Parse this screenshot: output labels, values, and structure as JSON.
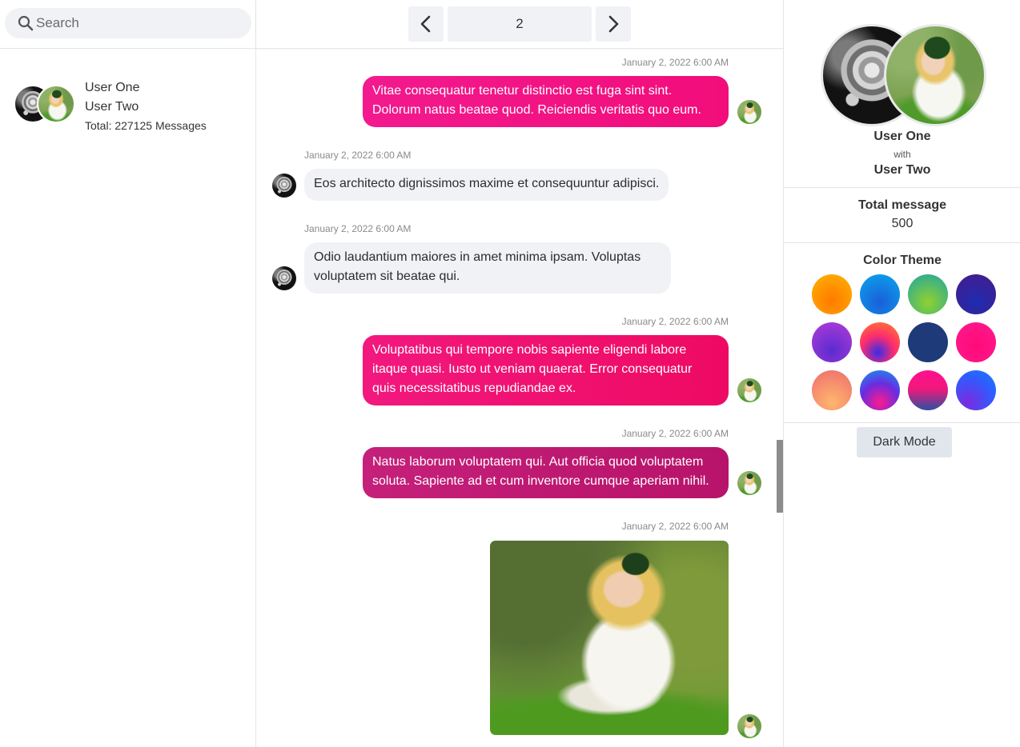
{
  "search": {
    "placeholder": "Search"
  },
  "conversation": {
    "user1": "User One",
    "user2": "User Two",
    "total": "Total: 227125 Messages"
  },
  "pager": {
    "page": "2"
  },
  "messages": [
    {
      "time": "January 2, 2022 6:00 AM",
      "text": "Vitae consequatur tenetur distinctio est fuga sint sint. Dolorum natus beatae quod. Reiciendis veritatis quo eum."
    },
    {
      "time": "January 2, 2022 6:00 AM",
      "text": "Eos architecto dignissimos maxime et consequuntur adipisci."
    },
    {
      "time": "January 2, 2022 6:00 AM",
      "text": "Odio laudantium maiores in amet minima ipsam. Voluptas voluptatem sit beatae qui."
    },
    {
      "time": "January 2, 2022 6:00 AM",
      "text": "Voluptatibus qui tempore nobis sapiente eligendi labore itaque quasi. Iusto ut veniam quaerat. Error consequatur quis necessitatibus repudiandae ex."
    },
    {
      "time": "January 2, 2022 6:00 AM",
      "text": "Natus laborum voluptatem qui. Aut officia quod voluptatem soluta. Sapiente ad et cum inventore cumque aperiam nihil."
    },
    {
      "time": "January 2, 2022 6:00 AM"
    }
  ],
  "profile": {
    "user1": "User One",
    "with": "with",
    "user2": "User Two"
  },
  "stats": {
    "label": "Total message",
    "value": "500"
  },
  "theme": {
    "label": "Color Theme",
    "swatches": [
      "radial-gradient(circle at 50% 65%, #ff7a00 0%, #ffb400 100%)",
      "radial-gradient(circle at 50% 70%, #1a5fd8 0%, #0aa6ee 100%)",
      "radial-gradient(circle at 50% 70%, #8fd12f 0%, #1fa6a0 100%)",
      "radial-gradient(circle at 50% 70%, #1d2cb0 0%, #4a1a8a 100%)",
      "radial-gradient(circle at 50% 70%, #5a2bd0 0%, #b53cd8 100%)",
      "radial-gradient(circle at 45% 75%, #3a2be8 0%, #ff2c6e 45%, #ff8a1f 100%)",
      "#1f3a78",
      "radial-gradient(circle at 50% 60%, #ff0a78 0%, #ff1a90 100%)",
      "radial-gradient(circle at 50% 80%, #ffb66e 0%, #ee6b6e 100%)",
      "radial-gradient(circle at 50% 80%, #ff1a8c 0%, #6b2be0 50%, #0a9ef0 100%)",
      "linear-gradient(180deg, #ff1090 0%, #f2187a 45%, #2e4fa0 100%)",
      "radial-gradient(circle at 30% 80%, #7a2be0 0%, #2f5cff 60%, #1a7fff 100%)"
    ]
  },
  "colors": {
    "bubble_1": "linear-gradient(90deg, #f21a8e 0%, #f20d7a 100%)",
    "bubble_4": "linear-gradient(90deg, #f2187e 0%, #ee0a63 100%)",
    "bubble_5": "linear-gradient(90deg, #c5207a 0%, #b8136a 100%)"
  },
  "dark_mode": {
    "label": "Dark Mode"
  }
}
